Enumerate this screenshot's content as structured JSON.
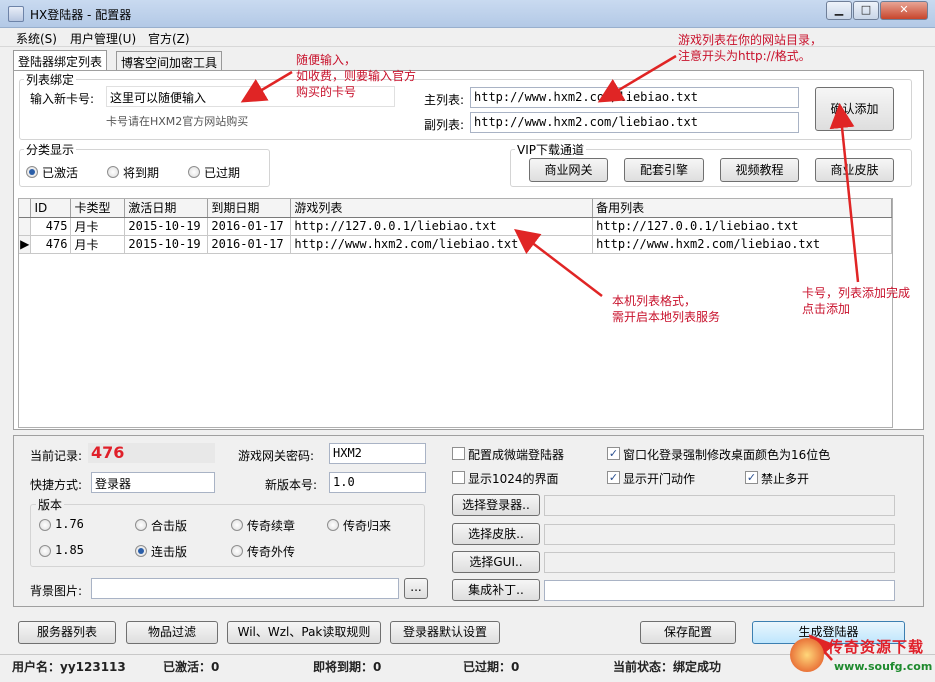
{
  "window": {
    "title": "HX登陆器 - 配置器"
  },
  "menu": [
    "系统(S)",
    "用户管理(U)",
    "官方(Z)"
  ],
  "tabs": [
    "登陆器绑定列表",
    "博客空间加密工具"
  ],
  "list_binding": {
    "legend": "列表绑定",
    "card_label": "输入新卡号:",
    "card_value": "这里可以随便输入",
    "card_hint": "卡号请在HXM2官方网站购买",
    "main_label": "主列表:",
    "main_value": "http://www.hxm2.com/liebiao.txt",
    "sub_label": "副列表:",
    "sub_value": "http://www.hxm2.com/liebiao.txt",
    "confirm_button": "确认添加"
  },
  "category": {
    "legend": "分类显示",
    "options": [
      "已激活",
      "将到期",
      "已过期"
    ],
    "selected": 0
  },
  "vip": {
    "legend": "VIP下载通道",
    "buttons": [
      "商业网关",
      "配套引擎",
      "视频教程",
      "商业皮肤"
    ]
  },
  "grid": {
    "columns": [
      "ID",
      "卡类型",
      "激活日期",
      "到期日期",
      "游戏列表",
      "备用列表"
    ],
    "rows": [
      [
        "475",
        "月卡",
        "2015-10-19",
        "2016-01-17",
        "http://127.0.0.1/liebiao.txt",
        "http://127.0.0.1/liebiao.txt"
      ],
      [
        "476",
        "月卡",
        "2015-10-19",
        "2016-01-17",
        "http://www.hxm2.com/liebiao.txt",
        "http://www.hxm2.com/liebiao.txt"
      ]
    ]
  },
  "config": {
    "current_label": "当前记录:",
    "current_value": "476",
    "gateway_label": "游戏网关密码:",
    "gateway_value": "HXM2",
    "shortcut_label": "快捷方式:",
    "shortcut_value": "登录器",
    "version_no_label": "新版本号:",
    "version_no_value": "1.0",
    "version_legend": "版本",
    "versions": [
      "1.76",
      "合击版",
      "传奇续章",
      "传奇归来",
      "1.85",
      "连击版",
      "传奇外传"
    ],
    "version_selected": 5,
    "bg_label": "背景图片:",
    "browse_button": "...",
    "checkboxes": [
      "配置成微端登陆器",
      "窗口化登录强制修改桌面颜色为16位色",
      "显示1024的界面",
      "显示开门动作",
      "禁止多开"
    ],
    "checked": [
      false,
      true,
      false,
      true,
      true
    ],
    "select_buttons": [
      "选择登录器..",
      "选择皮肤..",
      "选择GUI..",
      "集成补丁.."
    ]
  },
  "bottom_buttons": [
    "服务器列表",
    "物品过滤",
    "Wil、Wzl、Pak读取规则",
    "登录器默认设置",
    "保存配置",
    "生成登陆器"
  ],
  "status": {
    "user": "用户名：yy123113",
    "activated": "已激活：0",
    "expiring": "即将到期：0",
    "expired": "已过期：0",
    "state": "当前状态：绑定成功"
  },
  "annotations": {
    "note1": [
      "随便输入，",
      "如收费，则要输入官方",
      "购买的卡号"
    ],
    "note2": [
      "游戏列表在你的网站目录，",
      "注意开头为http://格式。"
    ],
    "note3": [
      "本机列表格式，",
      "需开启本地列表服务"
    ],
    "note4": [
      "卡号，列表添加完成",
      "点击添加"
    ]
  },
  "watermark": {
    "text": "传奇资源下载",
    "site": "www.soufg.com"
  }
}
